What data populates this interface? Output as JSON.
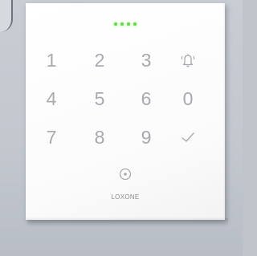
{
  "keypad": {
    "status_leds": [
      "green",
      "green",
      "green",
      "green"
    ],
    "led_color": "#6bd64c",
    "keys": [
      {
        "label": "1"
      },
      {
        "label": "2"
      },
      {
        "label": "3"
      },
      {
        "icon": "bell-icon"
      },
      {
        "label": "4"
      },
      {
        "label": "5"
      },
      {
        "label": "6"
      },
      {
        "label": "0"
      },
      {
        "label": "7"
      },
      {
        "label": "8"
      },
      {
        "label": "9"
      },
      {
        "icon": "checkmark-icon"
      }
    ],
    "center_key_icon": "target-icon",
    "brand": "LOXONE"
  }
}
